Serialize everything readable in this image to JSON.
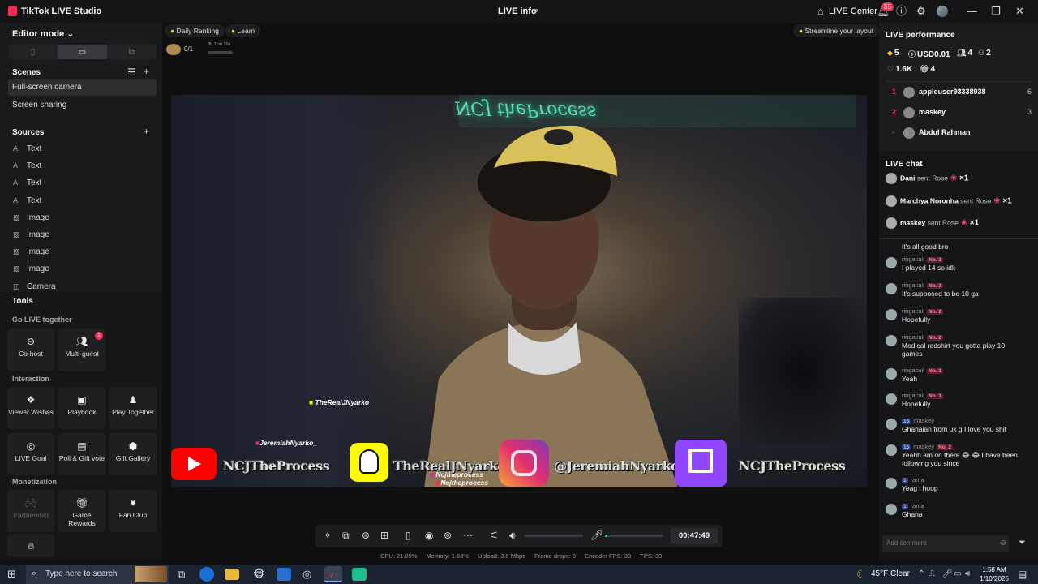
{
  "titlebar": {
    "app_title": "TikTok LIVE Studio",
    "center_title": "LIVE info",
    "share_icon": "share-icon",
    "live_center": "LIVE Center",
    "notification_count": "55",
    "minimize": "—",
    "maximize": "❐",
    "close": "✕"
  },
  "left": {
    "editor_mode": "Editor mode ⌄",
    "scenes_title": "Scenes",
    "scenes": [
      "Full-screen camera",
      "Screen sharing"
    ],
    "sources_title": "Sources",
    "sources": [
      {
        "icon": "text-icon",
        "label": "Text"
      },
      {
        "icon": "text-icon",
        "label": "Text"
      },
      {
        "icon": "text-icon",
        "label": "Text"
      },
      {
        "icon": "text-icon",
        "label": "Text"
      },
      {
        "icon": "image-icon",
        "label": "Image"
      },
      {
        "icon": "image-icon",
        "label": "Image"
      },
      {
        "icon": "image-icon",
        "label": "Image"
      },
      {
        "icon": "image-icon",
        "label": "Image"
      },
      {
        "icon": "camera-icon",
        "label": "Camera"
      }
    ],
    "tools_title": "Tools",
    "go_live_together": "Go LIVE together",
    "cohost": "Co-host",
    "multiguest": "Multi-guest",
    "multiguest_badge": "1",
    "interaction": "Interaction",
    "viewer_wishes": "Viewer Wishes",
    "playbook": "Playbook",
    "play_together": "Play Together",
    "live_goal": "LIVE Goal",
    "poll_gift": "Poll & Gift vote",
    "gift_gallery": "Gift Gallery",
    "monetization": "Monetization",
    "partnership": "Partnership",
    "game_rewards": "Game Rewards",
    "fan_club": "Fan Club"
  },
  "center": {
    "daily_ranking": "Daily Ranking",
    "learn": "Learn",
    "streamline": "Streamline your layout",
    "rank_progress": "0/1",
    "rank_timer": "3h 11m 10s",
    "video": {
      "neon_sign": "NCJ theProcess",
      "tag_snap": "TheRealJNyarko",
      "tag_ig": "JeremiahNyarko_",
      "tag_tt1": "Ncjtheprocess",
      "tag_tt2": "Ncjtheprocess",
      "yt_text": "NCJTheProcess",
      "snap_text": "TheRealJNyarko",
      "ig_text": "@JeremiahNyarko_",
      "twitch_text": "NCJTheProcess"
    },
    "timer": "00:47:49",
    "stats": {
      "cpu": "CPU: 21.09%",
      "memory": "Memory: 1.68%",
      "upload": "Upload: 3.8 Mbps",
      "frame_drops": "Frame drops: 0",
      "encoder_fps": "Encoder FPS: 30",
      "fps": "FPS: 30"
    },
    "mic_level": 0.04
  },
  "right": {
    "performance_title": "LIVE performance",
    "diamonds": "5",
    "usd": "USD0.01",
    "viewers": "4",
    "new_followers": "2",
    "likes": "1.6K",
    "gifters": "4",
    "ranking": [
      {
        "rank": "1",
        "name": "appleuser93338938",
        "score": "6"
      },
      {
        "rank": "2",
        "name": "maskey",
        "score": "3"
      },
      {
        "rank": "-",
        "name": "Abdul Rahman",
        "score": ""
      }
    ],
    "chat_title": "LIVE chat",
    "gifts": [
      {
        "name": "Dani",
        "action": "sent Rose",
        "count": "×1"
      },
      {
        "name": "Marchya Noronha",
        "action": "sent Rose",
        "count": "×1"
      },
      {
        "name": "maskey",
        "action": "sent Rose",
        "count": "×1"
      }
    ],
    "first_msg": "It's all good bro",
    "messages": [
      {
        "user": "ringacuil",
        "level": "",
        "badge": "No. 2",
        "text": "I played 14 so idk"
      },
      {
        "user": "ringacuil",
        "level": "",
        "badge": "No. 2",
        "text": "It's supposed to be 10 ga"
      },
      {
        "user": "ringacuil",
        "level": "",
        "badge": "No. 2",
        "text": "Hopefully"
      },
      {
        "user": "ringacuil",
        "level": "",
        "badge": "No. 2",
        "text": "Medical redshirt you gotta play 10 games"
      },
      {
        "user": "ringacuil",
        "level": "",
        "badge": "No. 1",
        "text": "Yeah"
      },
      {
        "user": "ringacuil",
        "level": "",
        "badge": "No. 1",
        "text": "Hopefully"
      },
      {
        "user": "maskey",
        "level": "15",
        "badge": "",
        "text": "Ghanaian from uk g I love you shit"
      },
      {
        "user": "maskey",
        "level": "15",
        "badge": "No. 2",
        "text": "Yeahh am on there 😂 😂 I have been following you since"
      },
      {
        "user": "rama",
        "level": "1",
        "badge": "",
        "text": "Yeag i hoop"
      },
      {
        "user": "rama",
        "level": "1",
        "badge": "",
        "text": "Ghana"
      }
    ],
    "comment_placeholder": "Add comment"
  },
  "taskbar": {
    "search_placeholder": "Type here to search",
    "weather": "45°F  Clear",
    "time": "1:58 AM",
    "date": "1/10/2026"
  }
}
